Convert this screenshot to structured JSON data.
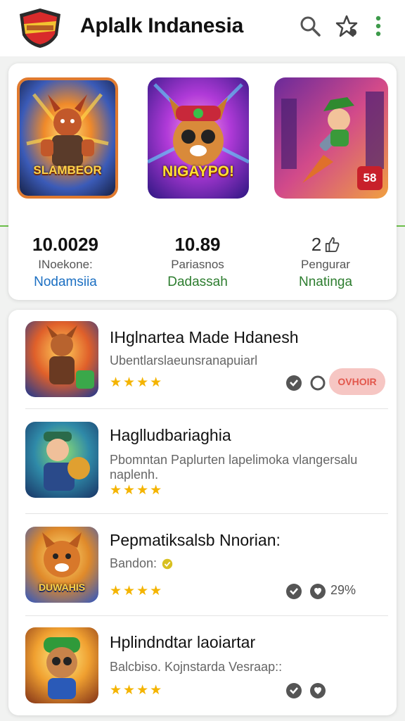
{
  "header": {
    "title": "Aplalk Indanesia",
    "icons": [
      "shield-logo",
      "search-icon",
      "star-icon",
      "more-icon"
    ]
  },
  "featured": {
    "tiles": [
      {
        "label": "SLAMBEOR",
        "badge": ""
      },
      {
        "label": "NIGAYPO!",
        "badge": ""
      },
      {
        "label": "",
        "badge": "58"
      }
    ],
    "stats": [
      {
        "value": "10.0029",
        "sub": "INoekone:",
        "link": "Nodamsiia"
      },
      {
        "value": "10.89",
        "sub": "Pariasnos",
        "link": "Dadassah"
      },
      {
        "value": "2",
        "sub": "Pengurar",
        "link": "Nnatinga"
      }
    ]
  },
  "list": {
    "items": [
      {
        "title": "IHglnartea Made Hdanesh",
        "subtitle": "Ubentlarslaeunsranapuiarl",
        "stars": "★★★★",
        "pill": "OVHOIR",
        "percent": ""
      },
      {
        "title": "Haglludbariaghia",
        "subtitle": "Pbomntan Paplurten lapelimoka vlangersalu naplenh.",
        "stars": "★★★★",
        "pill": "",
        "percent": ""
      },
      {
        "title": "Pepmatiksalsb Nnorian:",
        "subtitle": "Bandon:",
        "stars": "★★★★",
        "pill": "",
        "percent": "29%",
        "icon_label": "DUWAHIS"
      },
      {
        "title": "Hplindndtar laoiartar",
        "subtitle": "Balcbiso. Kojnstarda Vesraap::",
        "stars": "★★★★",
        "pill": "",
        "percent": ""
      }
    ]
  },
  "colors": {
    "accent_green": "#6cbf4a",
    "link_blue": "#1b6fc2",
    "link_green": "#2d7d2f",
    "star_gold": "#f4b400",
    "pill_bg": "#f6c6c3",
    "pill_text": "#e2574c"
  }
}
